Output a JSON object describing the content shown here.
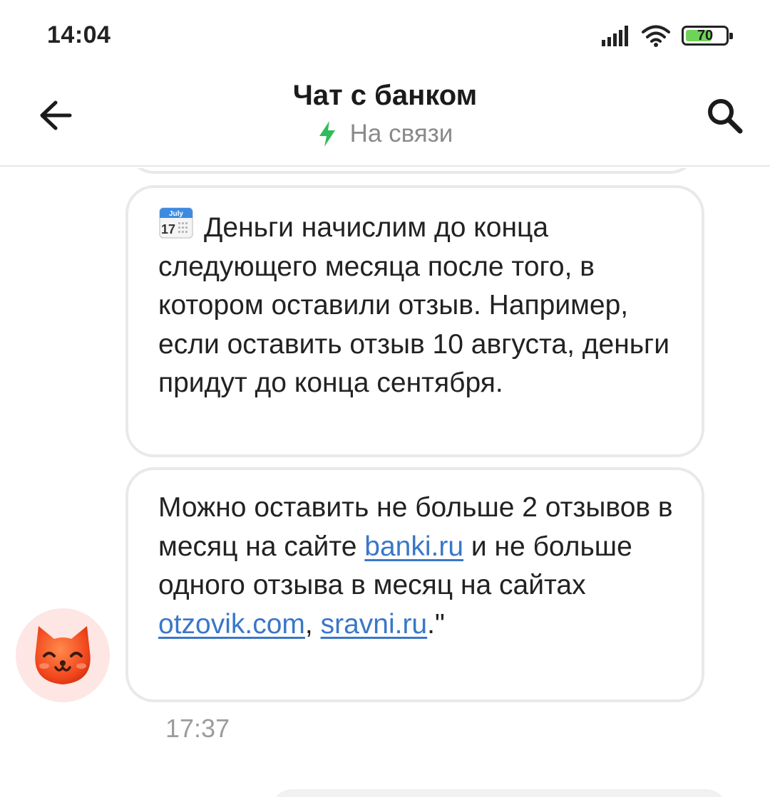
{
  "status_bar": {
    "time": "14:04",
    "battery_text": "70",
    "battery_level": 0.7,
    "icons": [
      "signal-icon",
      "wifi-icon",
      "battery-icon"
    ]
  },
  "header": {
    "title": "Чат с банком",
    "status": "На связи",
    "back_icon": "arrow-left-icon",
    "search_icon": "search-icon",
    "status_icon": "lightning-icon",
    "status_icon_color": "#2ebd59"
  },
  "messages": [
    {
      "emoji": "calendar-icon",
      "emoji_label": "July",
      "emoji_day": "17",
      "text": "Деньги начислим до конца следующего месяца после того, в котором оставили отзыв. Например, если оставить отзыв 10 августа, деньги придут до конца сентября."
    },
    {
      "text_1": "Можно оставить не больше 2 отзывов в месяц на сайте ",
      "link_1": "banki.ru",
      "text_2": " и не больше одного отзыва в месяц на сайтах ",
      "link_2": "otzovik.com",
      "text_3": ", ",
      "link_3": "sravni.ru",
      "text_4": ".\"",
      "time": "17:37"
    }
  ],
  "avatar": {
    "icon": "cat-avatar-icon",
    "color": "#f1471d"
  },
  "colors": {
    "link": "#3a77c8",
    "bubble_border": "#e9e9e9",
    "muted_text": "#8a8a8a"
  }
}
